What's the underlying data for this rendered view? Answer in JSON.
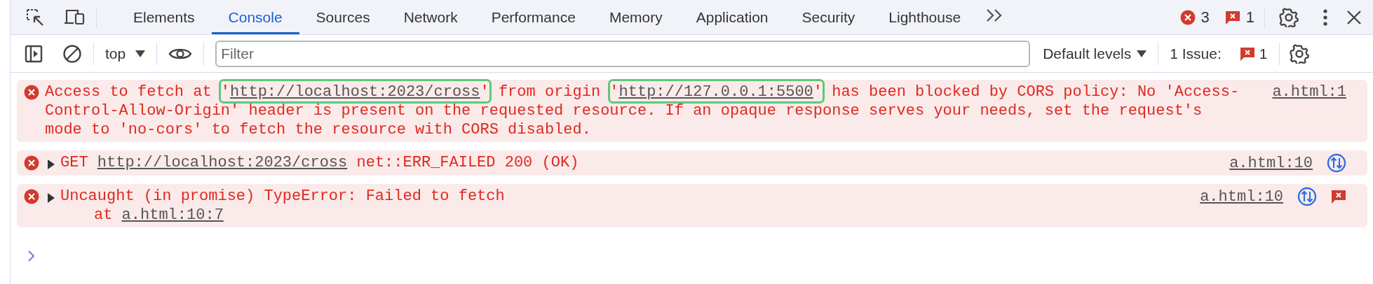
{
  "tabs": [
    {
      "label": "Elements",
      "selected": false
    },
    {
      "label": "Console",
      "selected": true
    },
    {
      "label": "Sources",
      "selected": false
    },
    {
      "label": "Network",
      "selected": false
    },
    {
      "label": "Performance",
      "selected": false
    },
    {
      "label": "Memory",
      "selected": false
    },
    {
      "label": "Application",
      "selected": false
    },
    {
      "label": "Security",
      "selected": false
    },
    {
      "label": "Lighthouse",
      "selected": false
    }
  ],
  "error_count": "3",
  "issue_count": "1",
  "toolbar": {
    "context": "top",
    "filter": {
      "placeholder": "Filter"
    },
    "levels": "Default levels",
    "issues_label": "1 Issue:",
    "issues_count": "1"
  },
  "messages": [
    {
      "expandable": false,
      "source": "a.html:1",
      "request_icon": false,
      "issue_icon": false,
      "lines": [
        [
          {
            "kind": "text",
            "text": "Access to fetch at '"
          },
          {
            "kind": "link",
            "text": "http://localhost:2023/cross",
            "highlighted": true
          },
          {
            "kind": "text",
            "text": "' from origin '"
          },
          {
            "kind": "link",
            "text": "http://127.0.0.1:5500",
            "highlighted": true
          },
          {
            "kind": "text",
            "text": "' has been blocked by CORS policy: No 'Access-Control-Allow-Origin' header is present on the requested resource. If an opaque response serves your needs, set the request's mode to 'no-cors' to fetch the resource with CORS disabled."
          }
        ]
      ]
    },
    {
      "expandable": true,
      "source": "a.html:10",
      "request_icon": true,
      "issue_icon": false,
      "lines": [
        [
          {
            "kind": "text",
            "text": "GET "
          },
          {
            "kind": "link",
            "text": "http://localhost:2023/cross",
            "highlighted": false
          },
          {
            "kind": "text",
            "text": " net::ERR_FAILED 200 (OK)"
          }
        ]
      ]
    },
    {
      "expandable": true,
      "source": "a.html:10",
      "request_icon": true,
      "issue_icon": true,
      "lines": [
        [
          {
            "kind": "text",
            "text": "Uncaught (in promise) TypeError: Failed to fetch"
          }
        ],
        [
          {
            "kind": "text",
            "text": "at "
          },
          {
            "kind": "link",
            "text": "a.html:10:7",
            "highlighted": false
          }
        ]
      ]
    }
  ]
}
